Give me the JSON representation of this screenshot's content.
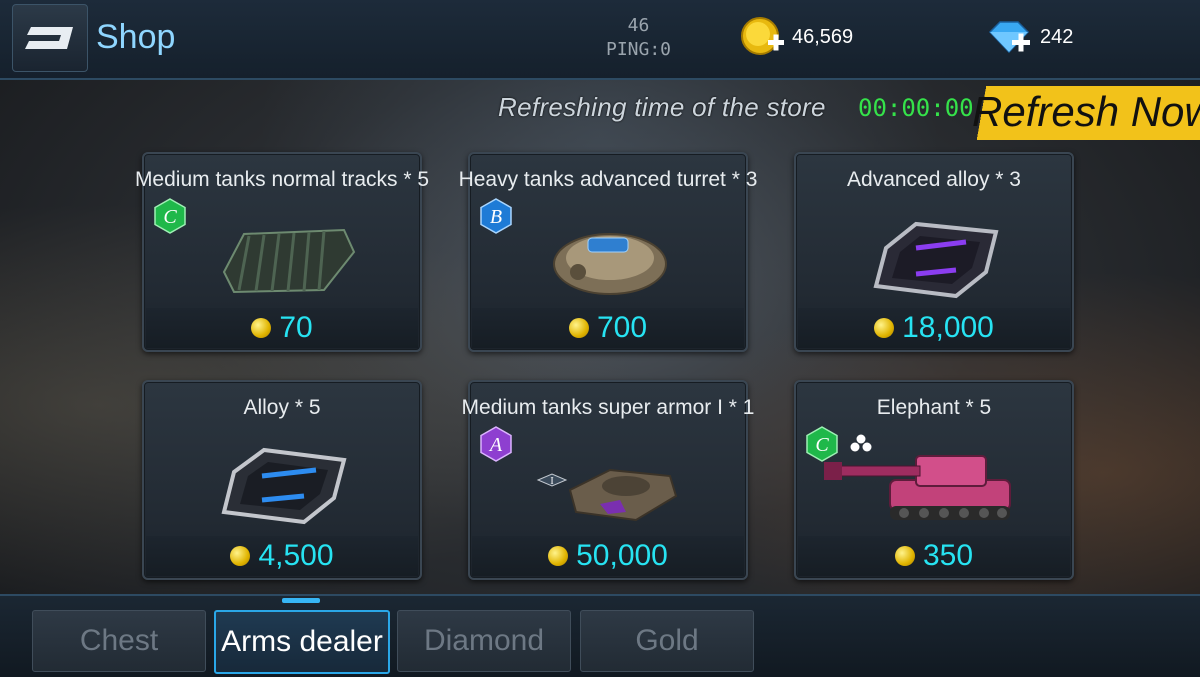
{
  "header": {
    "title": "Shop",
    "ping_value": "46",
    "ping_label": "PING:0",
    "gold": "46,569",
    "diamonds": "242"
  },
  "refresh": {
    "label": "Refreshing time of the store",
    "time": "00:00:00",
    "button": "Refresh Now"
  },
  "items": [
    {
      "name": "Medium tanks normal tracks * 5",
      "grade": "C",
      "grade_color": "#1fb84a",
      "price": "70",
      "icon": "tank-tracks-icon"
    },
    {
      "name": "Heavy tanks advanced turret * 3",
      "grade": "B",
      "grade_color": "#1e7bd6",
      "price": "700",
      "icon": "tank-turret-icon"
    },
    {
      "name": "Advanced alloy * 3",
      "grade": "",
      "price": "18,000",
      "icon": "advanced-alloy-icon"
    },
    {
      "name": "Alloy * 5",
      "grade": "",
      "price": "4,500",
      "icon": "alloy-icon"
    },
    {
      "name": "Medium tanks super armor I * 1",
      "grade": "A",
      "grade_color": "#8e3fd0",
      "price": "50,000",
      "icon": "tank-armor-icon",
      "badge": "I"
    },
    {
      "name": "Elephant * 5",
      "grade": "C",
      "grade_color": "#1fb84a",
      "price": "350",
      "icon": "elephant-tank-icon"
    }
  ],
  "tabs": [
    {
      "label": "Chest",
      "active": false
    },
    {
      "label": "Arms dealer",
      "active": true
    },
    {
      "label": "Diamond",
      "active": false
    },
    {
      "label": "Gold",
      "active": false
    }
  ]
}
